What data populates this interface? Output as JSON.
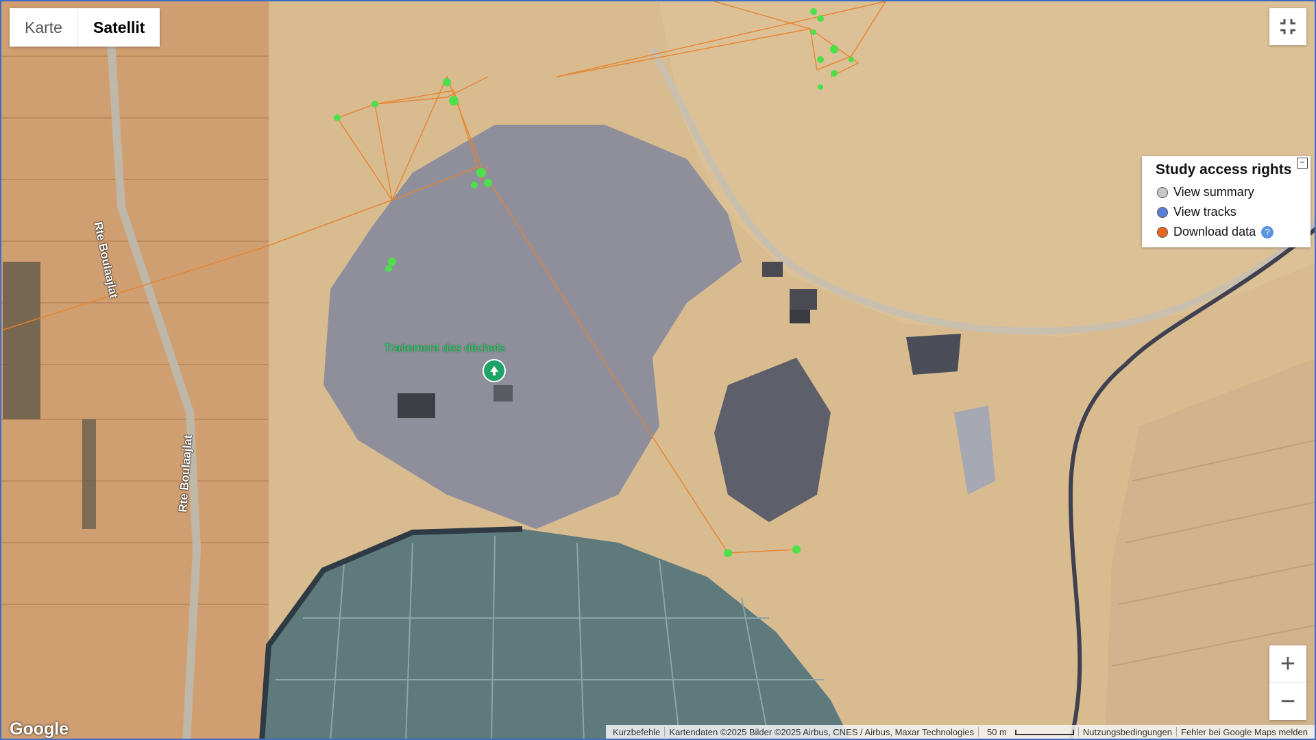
{
  "map_type": {
    "options": [
      "Karte",
      "Satellit"
    ],
    "selected": "Satellit"
  },
  "legend": {
    "title": "Study access rights",
    "items": [
      {
        "label": "View summary",
        "color": "#c8c8c8"
      },
      {
        "label": "View tracks",
        "color": "#5b7fd8"
      },
      {
        "label": "Download data",
        "color": "#e8671c"
      }
    ],
    "help_glyph": "?"
  },
  "labels": {
    "poi": "Traitement des déchets",
    "road_1": "Rte Boulaajlat",
    "road_2": "Rte Boulaajlat"
  },
  "zoom": {
    "in": "+",
    "out": "−"
  },
  "logo": "Google",
  "attribution": {
    "shortcuts": "Kurzbefehle",
    "map_data": "Kartendaten ©2025 Bilder ©2025 Airbus, CNES / Airbus, Maxar Technologies",
    "scale": "50 m",
    "terms": "Nutzungsbedingungen",
    "report": "Fehler bei Google Maps melden"
  },
  "colors": {
    "track_line": "#e8822a",
    "track_fix": "#4ce04a",
    "pin": "#1ea467"
  },
  "icons": [
    "fullscreen-exit-icon",
    "recycle-pin-icon",
    "help-icon"
  ]
}
